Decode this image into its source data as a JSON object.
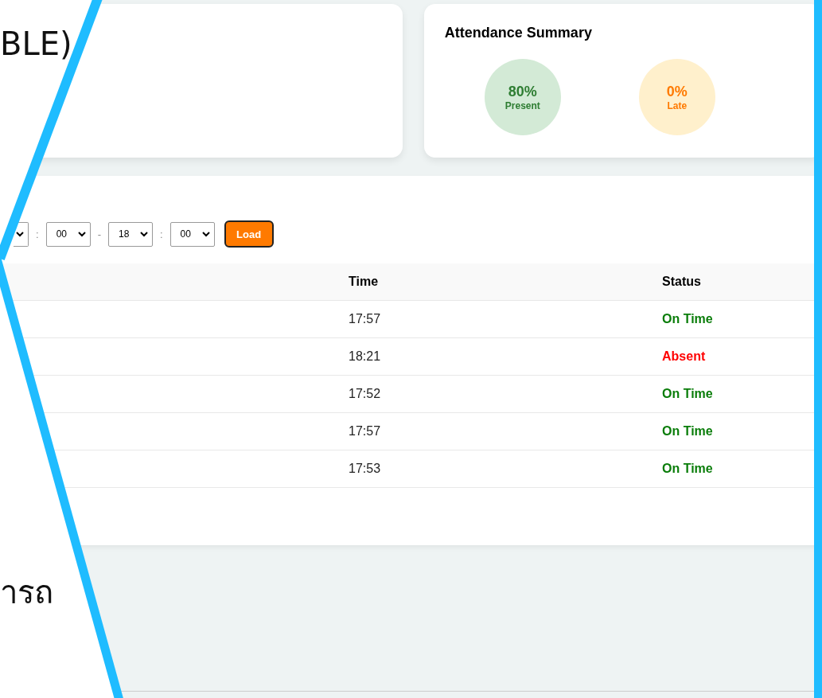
{
  "slide_texts": [
    {
      "text": "BLE)",
      "kind": "top"
    },
    {
      "text": "ารถ",
      "kind": "bottom"
    }
  ],
  "summary": {
    "title": "Attendance Summary",
    "items": [
      {
        "value": "80%",
        "label": "Present",
        "kind": "present"
      },
      {
        "value": "0%",
        "label": "Late",
        "kind": "late"
      }
    ]
  },
  "filter": {
    "selects": [
      {
        "kind": "cut"
      },
      {
        "value": "00"
      },
      {
        "value": "18"
      },
      {
        "value": "00"
      }
    ],
    "separators": [
      ":",
      "-",
      ":"
    ],
    "button": "Load"
  },
  "table": {
    "columns": [
      "Time",
      "Status"
    ],
    "rows": [
      {
        "time": "17:57",
        "status": "On Time",
        "kind": "on_time"
      },
      {
        "time": "18:21",
        "status": "Absent",
        "kind": "absent"
      },
      {
        "time": "17:52",
        "status": "On Time",
        "kind": "on_time"
      },
      {
        "time": "17:57",
        "status": "On Time",
        "kind": "on_time"
      },
      {
        "time": "17:53",
        "status": "On Time",
        "kind": "on_time"
      }
    ]
  }
}
